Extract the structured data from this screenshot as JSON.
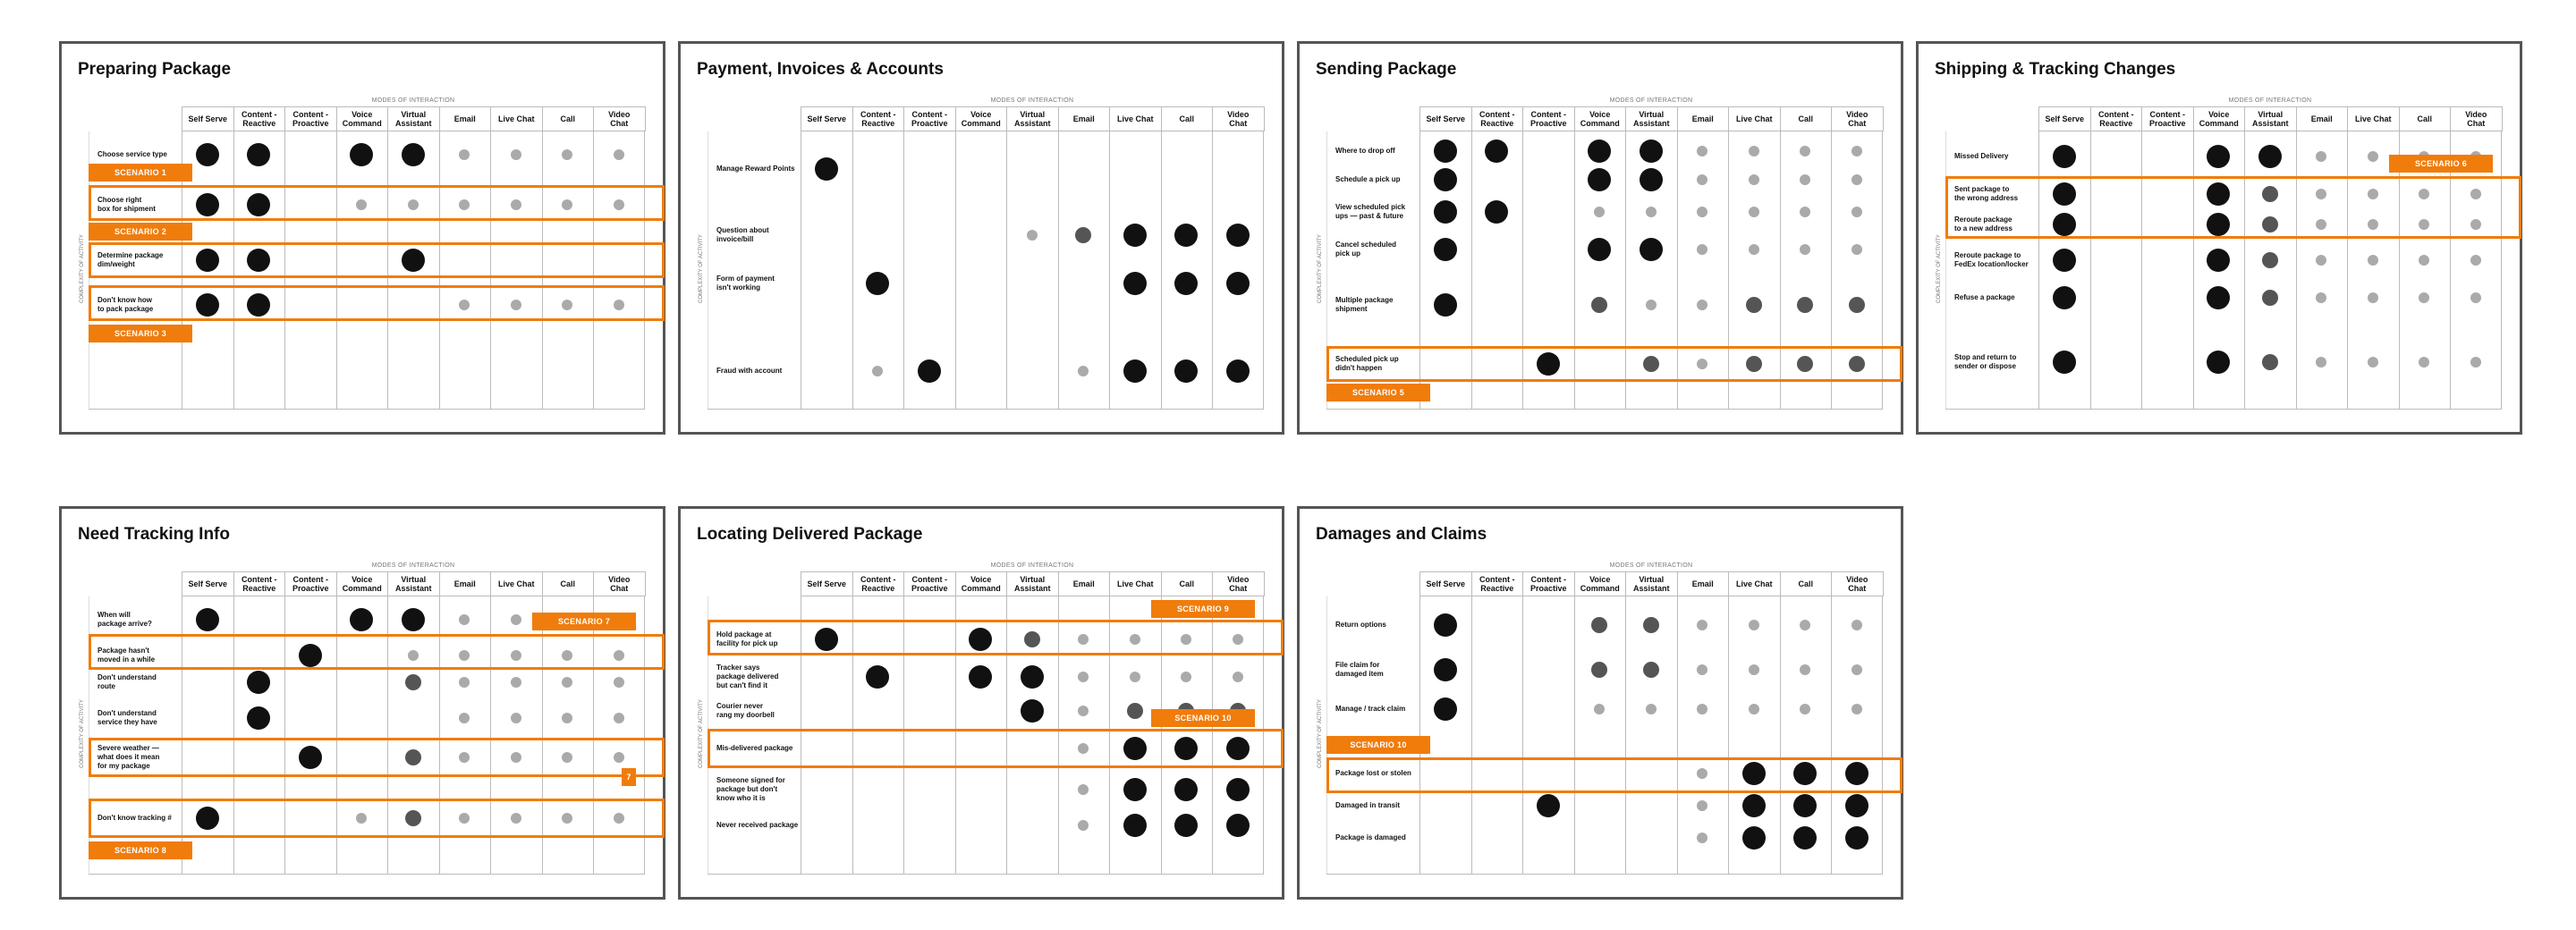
{
  "common": {
    "modes_label": "MODES OF INTERACTION",
    "axis_label": "COMPLEXITY OF ACTIVITY",
    "columns": [
      "Self Serve",
      "Content -\nReactive",
      "Content -\nProactive",
      "Voice\nCommand",
      "Virtual\nAssistant",
      "Email",
      "Live Chat",
      "Call",
      "Video\nChat"
    ],
    "colors": {
      "accent": "#f07c0c",
      "border": "#555555",
      "dot_big": "#111111",
      "dot_med": "#555555",
      "dot_small": "#aaaaaa"
    }
  },
  "panels": [
    {
      "title": "Preparing Package",
      "rows": [
        {
          "label": "Choose service type",
          "dots": [
            "L",
            "L",
            "",
            "L",
            "L",
            "S",
            "S",
            "S",
            "S"
          ]
        },
        {
          "label": "Choose right\nbox for shipment",
          "dots": [
            "L",
            "L",
            "",
            "S",
            "S",
            "S",
            "S",
            "S",
            "S"
          ]
        },
        {
          "label": "Determine package\ndim/weight",
          "dots": [
            "L",
            "L",
            "",
            "",
            "L",
            "",
            "",
            "",
            ""
          ]
        },
        {
          "label": "Don't know how\nto pack package",
          "dots": [
            "L",
            "L",
            "",
            "",
            "",
            "S",
            "S",
            "S",
            "S"
          ]
        }
      ],
      "scenarios": [
        "SCENARIO 1",
        "SCENARIO 2",
        "SCENARIO 3"
      ]
    },
    {
      "title": "Payment, Invoices & Accounts",
      "rows": [
        {
          "label": "Manage Reward Points",
          "dots": [
            "L",
            "",
            "",
            "",
            "",
            "",
            "",
            "",
            ""
          ]
        },
        {
          "label": "Question about\ninvoice/bill",
          "dots": [
            "",
            "",
            "",
            "",
            "S",
            "M",
            "L",
            "L",
            "L"
          ]
        },
        {
          "label": "Form of payment\nisn't working",
          "dots": [
            "",
            "L",
            "",
            "",
            "",
            "",
            "L",
            "L",
            "L"
          ]
        },
        {
          "label": "Fraud with account",
          "dots": [
            "",
            "S",
            "L",
            "",
            "",
            "S",
            "L",
            "L",
            "L"
          ]
        }
      ],
      "scenarios": []
    },
    {
      "title": "Sending Package",
      "rows": [
        {
          "label": "Where to drop off",
          "dots": [
            "L",
            "L",
            "",
            "L",
            "L",
            "S",
            "S",
            "S",
            "S"
          ]
        },
        {
          "label": "Schedule a pick up",
          "dots": [
            "L",
            "",
            "",
            "L",
            "L",
            "S",
            "S",
            "S",
            "S"
          ]
        },
        {
          "label": "View scheduled pick\nups — past & future",
          "dots": [
            "L",
            "L",
            "",
            "S",
            "S",
            "S",
            "S",
            "S",
            "S"
          ]
        },
        {
          "label": "Cancel scheduled\npick up",
          "dots": [
            "L",
            "",
            "",
            "L",
            "L",
            "S",
            "S",
            "S",
            "S"
          ]
        },
        {
          "label": "Multiple package\nshipment",
          "dots": [
            "L",
            "",
            "",
            "M",
            "S",
            "S",
            "M",
            "M",
            "M"
          ]
        },
        {
          "label": "Scheduled pick up\ndidn't happen",
          "dots": [
            "",
            "",
            "L",
            "",
            "M",
            "S",
            "M",
            "M",
            "M"
          ]
        }
      ],
      "scenarios": [
        "SCENARIO 5"
      ]
    },
    {
      "title": "Shipping & Tracking Changes",
      "rows": [
        {
          "label": "Missed Delivery",
          "dots": [
            "L",
            "",
            "",
            "L",
            "L",
            "S",
            "S",
            "S",
            "S"
          ]
        },
        {
          "label": "Sent package to\nthe wrong address",
          "dots": [
            "L",
            "",
            "",
            "L",
            "M",
            "S",
            "S",
            "S",
            "S"
          ]
        },
        {
          "label": "Reroute package\nto a new address",
          "dots": [
            "L",
            "",
            "",
            "L",
            "M",
            "S",
            "S",
            "S",
            "S"
          ]
        },
        {
          "label": "Reroute package to\nFedEx location/locker",
          "dots": [
            "L",
            "",
            "",
            "L",
            "M",
            "S",
            "S",
            "S",
            "S"
          ]
        },
        {
          "label": "Refuse a package",
          "dots": [
            "L",
            "",
            "",
            "L",
            "M",
            "S",
            "S",
            "S",
            "S"
          ]
        },
        {
          "label": "Stop and return to\nsender or dispose",
          "dots": [
            "L",
            "",
            "",
            "L",
            "M",
            "S",
            "S",
            "S",
            "S"
          ]
        }
      ],
      "scenarios": [
        "SCENARIO 6"
      ]
    },
    {
      "title": "Need Tracking Info",
      "rows": [
        {
          "label": "When will\npackage arrive?",
          "dots": [
            "L",
            "",
            "",
            "L",
            "L",
            "S",
            "S",
            "S",
            "S"
          ]
        },
        {
          "label": "Package hasn't\nmoved in a while",
          "dots": [
            "",
            "",
            "L",
            "",
            "S",
            "S",
            "S",
            "S",
            "S"
          ]
        },
        {
          "label": "Don't understand\nroute",
          "dots": [
            "",
            "L",
            "",
            "",
            "M",
            "S",
            "S",
            "S",
            "S"
          ]
        },
        {
          "label": "Don't understand\nservice they have",
          "dots": [
            "",
            "L",
            "",
            "",
            "",
            "S",
            "S",
            "S",
            "S"
          ]
        },
        {
          "label": "Severe weather —\nwhat does it mean\nfor my package",
          "dots": [
            "",
            "",
            "L",
            "",
            "M",
            "S",
            "S",
            "S",
            "S"
          ]
        },
        {
          "label": "Don't know tracking #",
          "dots": [
            "L",
            "",
            "",
            "S",
            "M",
            "S",
            "S",
            "S",
            "S"
          ]
        }
      ],
      "scenarios": [
        "SCENARIO 7",
        "7",
        "SCENARIO 8"
      ]
    },
    {
      "title": "Locating Delivered Package",
      "rows": [
        {
          "label": "Hold package at\nfacility for pick up",
          "dots": [
            "L",
            "",
            "",
            "L",
            "M",
            "S",
            "S",
            "S",
            "S"
          ]
        },
        {
          "label": "Tracker says\npackage delivered\nbut can't find it",
          "dots": [
            "",
            "L",
            "",
            "L",
            "L",
            "S",
            "S",
            "S",
            "S"
          ]
        },
        {
          "label": "Courier never\nrang my doorbell",
          "dots": [
            "",
            "",
            "",
            "",
            "L",
            "S",
            "M",
            "M",
            "M"
          ]
        },
        {
          "label": "Mis-delivered package",
          "dots": [
            "",
            "",
            "",
            "",
            "",
            "S",
            "L",
            "L",
            "L"
          ]
        },
        {
          "label": "Someone signed for\npackage but don't\nknow who it is",
          "dots": [
            "",
            "",
            "",
            "",
            "",
            "S",
            "L",
            "L",
            "L"
          ]
        },
        {
          "label": "Never received package",
          "dots": [
            "",
            "",
            "",
            "",
            "",
            "S",
            "L",
            "L",
            "L"
          ]
        }
      ],
      "scenarios": [
        "SCENARIO 9",
        "SCENARIO 10"
      ]
    },
    {
      "title": "Damages and Claims",
      "rows": [
        {
          "label": "Return options",
          "dots": [
            "L",
            "",
            "",
            "M",
            "M",
            "S",
            "S",
            "S",
            "S"
          ]
        },
        {
          "label": "File claim for\ndamaged item",
          "dots": [
            "L",
            "",
            "",
            "M",
            "M",
            "S",
            "S",
            "S",
            "S"
          ]
        },
        {
          "label": "Manage / track claim",
          "dots": [
            "L",
            "",
            "",
            "S",
            "S",
            "S",
            "S",
            "S",
            "S"
          ]
        },
        {
          "label": "Package lost or stolen",
          "dots": [
            "",
            "",
            "",
            "",
            "",
            "S",
            "L",
            "L",
            "L"
          ]
        },
        {
          "label": "Damaged in transit",
          "dots": [
            "",
            "",
            "L",
            "",
            "",
            "S",
            "L",
            "L",
            "L"
          ]
        },
        {
          "label": "Package is damaged",
          "dots": [
            "",
            "",
            "",
            "",
            "",
            "S",
            "L",
            "L",
            "L"
          ]
        }
      ],
      "scenarios": [
        "SCENARIO 10"
      ]
    }
  ]
}
